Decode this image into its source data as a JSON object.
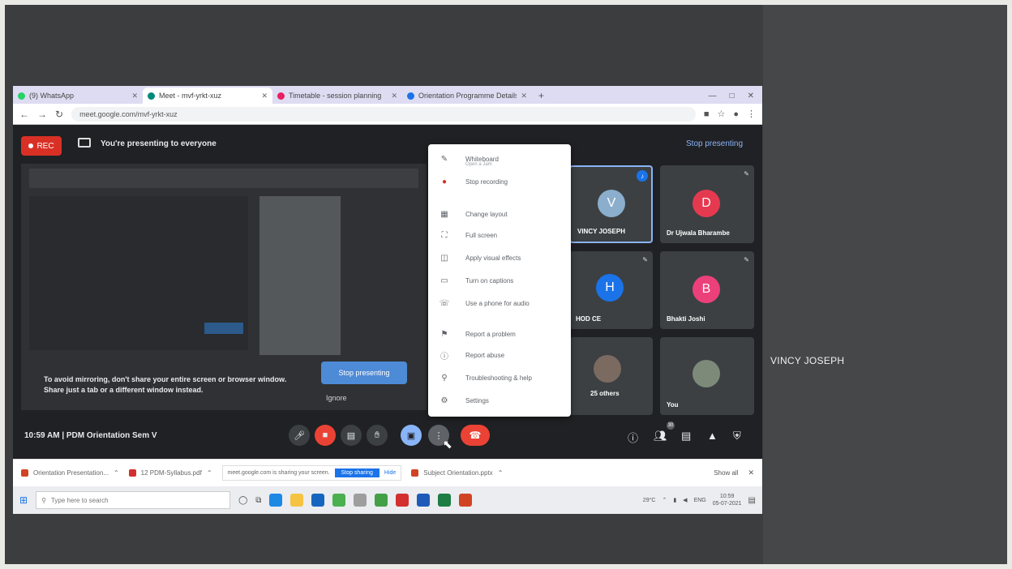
{
  "browser": {
    "tabs": [
      {
        "label": "(9) WhatsApp",
        "color": "#25d366"
      },
      {
        "label": "Meet - mvf-yrkt-xuz",
        "color": "#00897b"
      },
      {
        "label": "Timetable - session planning",
        "color": "#e91e63"
      },
      {
        "label": "Orientation Programme Details",
        "color": "#1a73e8"
      }
    ],
    "new_tab": "+",
    "url": "meet.google.com/mvf-yrkt-xuz",
    "window_controls": [
      "—",
      "□",
      "✕"
    ]
  },
  "meet": {
    "rec_label": "REC",
    "presenting_text": "You're presenting to everyone",
    "stop_presenting_top": "Stop presenting",
    "mirror_warning_line1": "To avoid mirroring, don't share your entire screen or browser window.",
    "mirror_warning_line2": "Share just a tab or a different window instead.",
    "stop_presenting_button": "Stop presenting",
    "ignore_label": "Ignore",
    "time_and_meeting": "10:59 AM  |  PDM Orientation Sem V",
    "more_options_menu": [
      {
        "icon": "✎",
        "label": "Whiteboard",
        "sub": "Open a Jam"
      },
      {
        "icon": "●",
        "label": "Stop recording",
        "sub": ""
      },
      {
        "icon": "▦",
        "label": "Change layout",
        "sub": ""
      },
      {
        "icon": "⛶",
        "label": "Full screen",
        "sub": ""
      },
      {
        "icon": "◫",
        "label": "Apply visual effects",
        "sub": ""
      },
      {
        "icon": "▭",
        "label": "Turn on captions",
        "sub": ""
      },
      {
        "icon": "☏",
        "label": "Use a phone for audio",
        "sub": ""
      },
      {
        "icon": "⚑",
        "label": "Report a problem",
        "sub": ""
      },
      {
        "icon": "ⓘ",
        "label": "Report abuse",
        "sub": ""
      },
      {
        "icon": "⚲",
        "label": "Troubleshooting & help",
        "sub": ""
      },
      {
        "icon": "⚙",
        "label": "Settings",
        "sub": ""
      }
    ],
    "participants": [
      {
        "initial": "V",
        "name": "VINCY JOSEPH",
        "color": "#8aaecb"
      },
      {
        "initial": "D",
        "name": "Dr Ujwala Bharambe",
        "color": "#e53950"
      },
      {
        "initial": "H",
        "name": "HOD CE",
        "color": "#1a73e8"
      },
      {
        "initial": "B",
        "name": "Bhakti Joshi",
        "color": "#ec407a"
      },
      {
        "initial": "",
        "name": "25 others",
        "color": "#7a6a60"
      },
      {
        "initial": "",
        "name": "You",
        "color": "#7d8a7a"
      }
    ],
    "people_count": "30"
  },
  "pinned": {
    "initial": "V",
    "name": "VINCY JOSEPH"
  },
  "downloads": {
    "items": [
      "Orientation Presentation...",
      "12 PDM-Syllabus.pdf",
      "Subject Orientation.pptx"
    ],
    "sharing_message": "meet.google.com is sharing your screen.",
    "sharing_stop": "Stop sharing",
    "sharing_hide": "Hide",
    "show_all": "Show all"
  },
  "taskbar": {
    "search_placeholder": "Type here to search",
    "weather": "29°C",
    "language": "ENG",
    "time": "10:59",
    "date": "05-07-2021"
  },
  "colors": {
    "rec_red": "#d93025",
    "accent_blue": "#1a73e8",
    "end_call": "#ea4335"
  }
}
